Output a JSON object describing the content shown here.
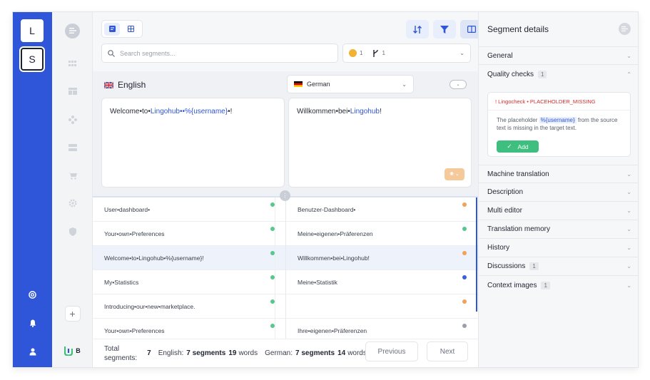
{
  "rail": {
    "workspace_l": "L",
    "workspace_s": "S"
  },
  "nav2": {
    "bottom_label": "B"
  },
  "toolbar": {
    "search_placeholder": "Search segments..."
  },
  "filters": {
    "warning_count": "1",
    "branch_count": "1"
  },
  "editor": {
    "source_language": "English",
    "target_language": "German",
    "source_text": {
      "before": "Welcome•to•",
      "brand": "Lingohub",
      "mid": "••",
      "placeholder": "%{username}",
      "after": "•!"
    },
    "target_text": {
      "before": "Willkommen•bei•",
      "brand": "Lingohub",
      "after": "!"
    }
  },
  "segments": [
    {
      "source": "User•dashboard•",
      "target": "Benutzer-Dashboard•",
      "source_status": "#56c88d",
      "target_status": "#f0a15a",
      "selected": false
    },
    {
      "source": "Your•own•Preferences",
      "target": "Meine•eigenen•Präferenzen",
      "source_status": "#56c88d",
      "target_status": "#56c88d",
      "selected": false
    },
    {
      "source": "Welcome•to•Lingohub•%{username}!",
      "target": "Willkommen•bei•Lingohub!",
      "source_status": "#56c88d",
      "target_status": "#f0a15a",
      "selected": true
    },
    {
      "source": "My•Statistics",
      "target": "Meine•Statistik",
      "source_status": "#56c88d",
      "target_status": "#3b63d6",
      "selected": false
    },
    {
      "source": "Introducing•our•new•marketplace.",
      "target": "",
      "source_status": "#56c88d",
      "target_status": "#f0a15a",
      "selected": false
    },
    {
      "source": "Your•own•Preferences",
      "target": "Ihre•eigenen•Präferenzen",
      "source_status": "#56c88d",
      "target_status": "#9aa0aa",
      "selected": false
    }
  ],
  "footer": {
    "total_label_1": "Total",
    "total_label_2": "segments:",
    "total_value": "7",
    "english_label": "English:",
    "english_segments": "7 segments",
    "english_words_n": "19",
    "english_words": "words",
    "german_label": "German:",
    "german_segments": "7 segments",
    "german_words_n": "14",
    "german_words": "words",
    "previous": "Previous",
    "next": "Next"
  },
  "panel": {
    "title": "Segment details",
    "sections": {
      "general": "General",
      "quality_checks": "Quality checks",
      "quality_checks_count": "1",
      "machine_translation": "Machine translation",
      "description": "Description",
      "multi_editor": "Multi editor",
      "translation_memory": "Translation memory",
      "history": "History",
      "discussions": "Discussions",
      "discussions_count": "1",
      "context_images": "Context images",
      "context_images_count": "1"
    },
    "qc": {
      "title": "! Lingocheck • PLACEHOLDER_MISSING",
      "text_before": "The placeholder ",
      "code": "%{username}",
      "text_after": " from the source text is missing in the target text.",
      "add": "Add"
    }
  },
  "colors": {
    "accent": "#2f56d8",
    "success": "#3fbf7f",
    "warning": "#f0a15a",
    "error": "#d12c2c"
  }
}
